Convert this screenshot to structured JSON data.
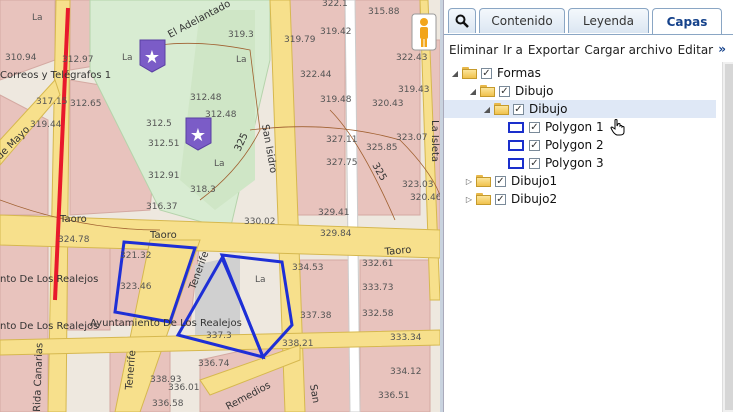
{
  "tabs": [
    {
      "label": "Contenido"
    },
    {
      "label": "Leyenda"
    },
    {
      "label": "Capas"
    }
  ],
  "toolbar": {
    "items": [
      "Eliminar",
      "Ir a",
      "Exportar",
      "Cargar archivo",
      "Editar"
    ],
    "more": "»"
  },
  "tree": {
    "root": "Formas",
    "group": "Dibujo",
    "layer": "Dibujo",
    "polygons": [
      "Polygon 1",
      "Polygon 2",
      "Polygon 3"
    ],
    "others": [
      "Dibujo1",
      "Dibujo2"
    ]
  },
  "map": {
    "streets": [
      "Taoro",
      "Taoro",
      "Taoro",
      "San Isidro",
      "La Isleta",
      "Remedios",
      "Tenerife",
      "Tenerife",
      "El Adelantado",
      "de Mayo",
      "San",
      "Rida Canarias",
      "Correos y Telégrafos 1",
      "nto De Los Realejos",
      "nto De Los Realejos",
      "Ayuntamiento De Los Realejos",
      "325",
      "325"
    ],
    "spot_heights": [
      "310.94",
      "312.97",
      "317.15",
      "319.44",
      "312.65",
      "315.88",
      "319.3",
      "319.79",
      "322.44",
      "319.42",
      "319.43",
      "322.43",
      "312.5",
      "312.48",
      "312.51",
      "312.48",
      "318.3",
      "312.91",
      "316.37",
      "320.46",
      "323.07",
      "327.11",
      "327.75",
      "325.85",
      "323.03",
      "330.02",
      "329.41",
      "329.84",
      "324.78",
      "321.32",
      "323.46",
      "334.53",
      "332.61",
      "333.73",
      "332.58",
      "337.3",
      "338.21",
      "337.38",
      "333.34",
      "336.74",
      "338.93",
      "336.01",
      "336.58",
      "334.12",
      "336.51",
      "322.1",
      "320.43",
      "319.48"
    ],
    "labels": [
      "La",
      "La",
      "La",
      "La",
      "La"
    ],
    "colors": {
      "route": "#e8192c",
      "polygon": "#1e2fd6",
      "poi": "#7b5cc7"
    }
  }
}
